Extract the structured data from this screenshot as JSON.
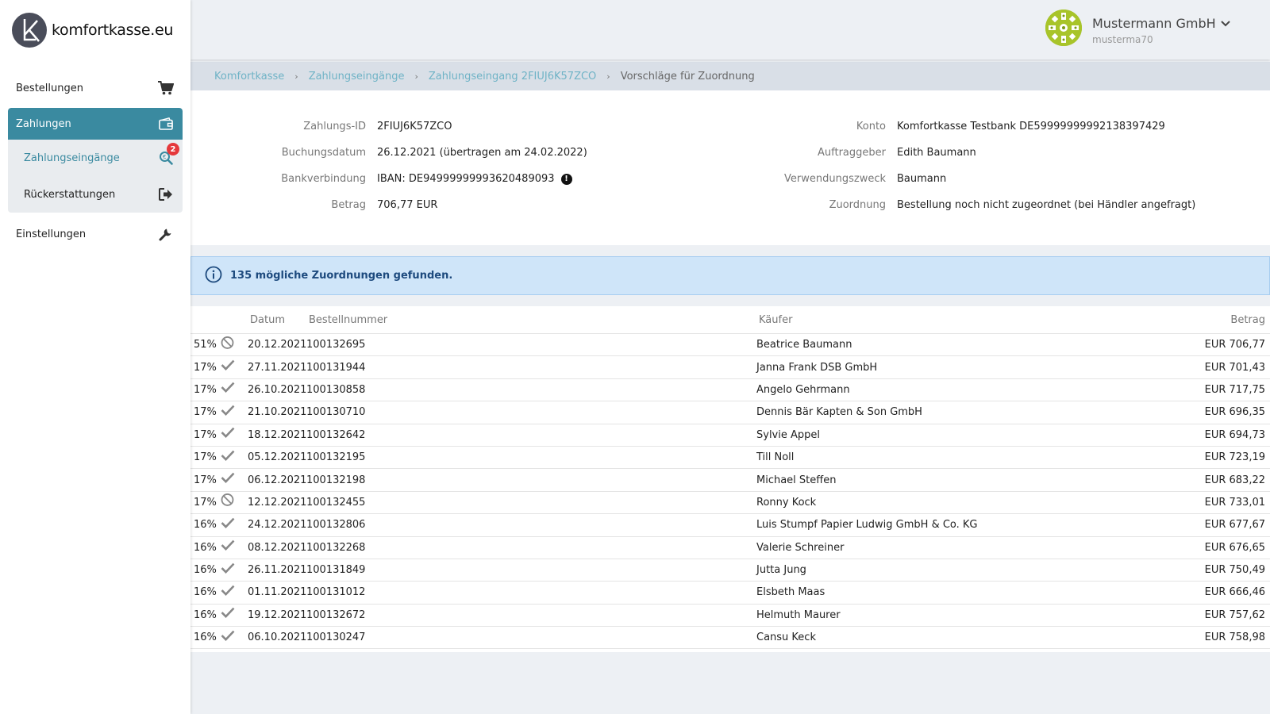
{
  "brand": {
    "name": "komfortkasse.eu"
  },
  "sidebar": {
    "items": [
      {
        "label": "Bestellungen",
        "icon": "cart-icon"
      },
      {
        "label": "Zahlungen",
        "icon": "wallet-icon"
      },
      {
        "label": "Zahlungseingänge",
        "icon": "search-euro-icon",
        "badge": "2"
      },
      {
        "label": "Rückerstattungen",
        "icon": "sign-out-icon"
      },
      {
        "label": "Einstellungen",
        "icon": "wrench-icon"
      }
    ]
  },
  "account": {
    "name": "Mustermann GmbH",
    "username": "musterma70"
  },
  "breadcrumb": [
    "Komfortkasse",
    "Zahlungseingänge",
    "Zahlungseingang 2FIUJ6K57ZCO",
    "Vorschläge für Zuordnung"
  ],
  "details": {
    "left": [
      {
        "label": "Zahlungs-ID",
        "value": "2FIUJ6K57ZCO"
      },
      {
        "label": "Buchungsdatum",
        "value": "26.12.2021 (übertragen am 24.02.2022)"
      },
      {
        "label": "Bankverbindung",
        "value": "IBAN: DE94999999993620489093"
      },
      {
        "label": "Betrag",
        "value": "706,77 EUR"
      }
    ],
    "right": [
      {
        "label": "Konto",
        "value": "Komfortkasse Testbank DE59999999992138397429"
      },
      {
        "label": "Auftraggeber",
        "value": "Edith Baumann"
      },
      {
        "label": "Verwendungszweck",
        "value": "Baumann"
      },
      {
        "label": "Zuordnung",
        "value": "Bestellung noch nicht zugeordnet (bei Händler angefragt)"
      }
    ]
  },
  "alert": {
    "text": "135 mögliche Zuordnungen gefunden."
  },
  "table": {
    "headers": {
      "datum": "Datum",
      "bestellnummer": "Bestellnummer",
      "kaeufer": "Käufer",
      "betrag": "Betrag"
    },
    "rows": [
      {
        "pct": "51%",
        "status": "ban",
        "date": "20.12.2021",
        "order": "100132695",
        "buyer": "Beatrice Baumann",
        "amount": "EUR 706,77"
      },
      {
        "pct": "17%",
        "status": "check",
        "date": "27.11.2021",
        "order": "100131944",
        "buyer": "Janna Frank DSB GmbH",
        "amount": "EUR 701,43"
      },
      {
        "pct": "17%",
        "status": "check",
        "date": "26.10.2021",
        "order": "100130858",
        "buyer": "Angelo Gehrmann",
        "amount": "EUR 717,75"
      },
      {
        "pct": "17%",
        "status": "check",
        "date": "21.10.2021",
        "order": "100130710",
        "buyer": "Dennis Bär Kapten & Son GmbH",
        "amount": "EUR 696,35"
      },
      {
        "pct": "17%",
        "status": "check",
        "date": "18.12.2021",
        "order": "100132642",
        "buyer": "Sylvie Appel",
        "amount": "EUR 694,73"
      },
      {
        "pct": "17%",
        "status": "check",
        "date": "05.12.2021",
        "order": "100132195",
        "buyer": "Till Noll",
        "amount": "EUR 723,19"
      },
      {
        "pct": "17%",
        "status": "check",
        "date": "06.12.2021",
        "order": "100132198",
        "buyer": "Michael Steffen",
        "amount": "EUR 683,22"
      },
      {
        "pct": "17%",
        "status": "ban",
        "date": "12.12.2021",
        "order": "100132455",
        "buyer": "Ronny Kock",
        "amount": "EUR 733,01"
      },
      {
        "pct": "16%",
        "status": "check",
        "date": "24.12.2021",
        "order": "100132806",
        "buyer": "Luis Stumpf Papier Ludwig GmbH & Co. KG",
        "amount": "EUR 677,67"
      },
      {
        "pct": "16%",
        "status": "check",
        "date": "08.12.2021",
        "order": "100132268",
        "buyer": "Valerie Schreiner",
        "amount": "EUR 676,65"
      },
      {
        "pct": "16%",
        "status": "check",
        "date": "26.11.2021",
        "order": "100131849",
        "buyer": "Jutta Jung",
        "amount": "EUR 750,49"
      },
      {
        "pct": "16%",
        "status": "check",
        "date": "01.11.2021",
        "order": "100131012",
        "buyer": "Elsbeth Maas",
        "amount": "EUR 666,46"
      },
      {
        "pct": "16%",
        "status": "check",
        "date": "19.12.2021",
        "order": "100132672",
        "buyer": "Helmuth Maurer",
        "amount": "EUR 757,62"
      },
      {
        "pct": "16%",
        "status": "check",
        "date": "06.10.2021",
        "order": "100130247",
        "buyer": "Cansu Keck",
        "amount": "EUR 758,98"
      }
    ]
  }
}
